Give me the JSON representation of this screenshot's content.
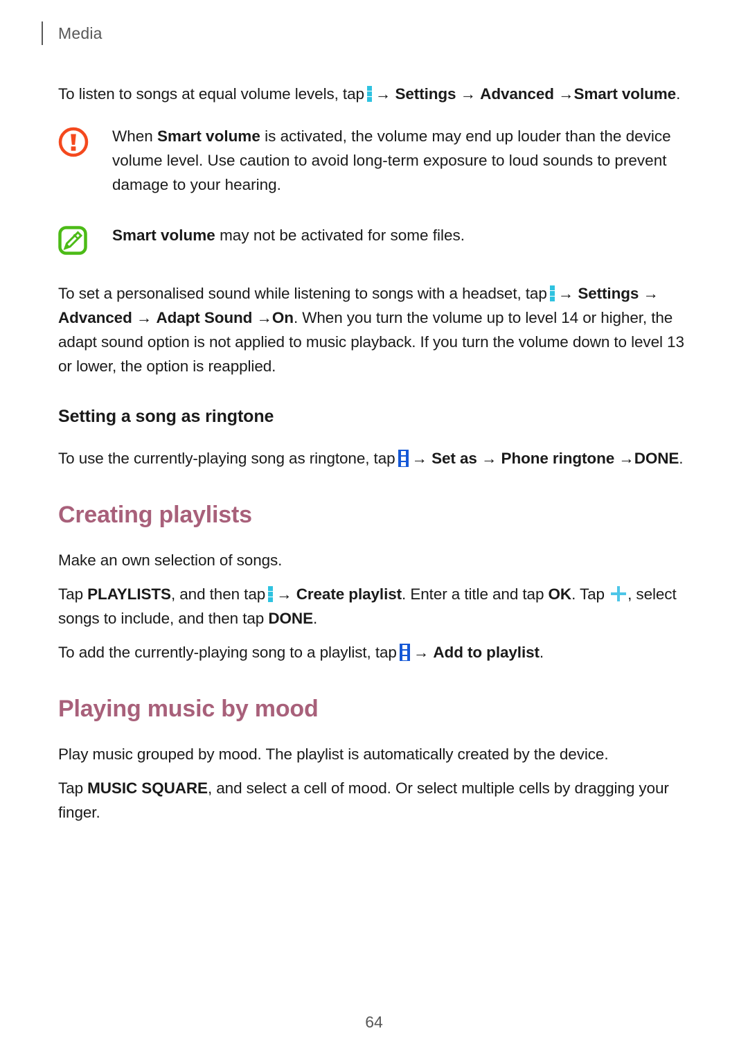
{
  "header": {
    "chapter_label": "Media"
  },
  "icons": {
    "more_menu": "more-vertical-icon",
    "more_menu_highlighted": "more-vertical-highlighted-icon",
    "plus": "plus-icon",
    "warning": "warning-icon",
    "note": "note-pencil-icon"
  },
  "colors": {
    "section_heading": "#a8607a",
    "inline_icon_cyan": "#2fc2e0",
    "inline_icon_highlight_bg": "#1558d6",
    "warning_icon": "#f4491e",
    "note_icon": "#4cbb17",
    "body_text": "#1a1a1a",
    "header_text": "#585858"
  },
  "content": {
    "smart_volume_intro": {
      "lead": "To listen to songs at equal volume levels, tap",
      "step_1": "Settings",
      "step_2": "Advanced",
      "step_3": "Smart volume",
      "trailing": "."
    },
    "warning_callout": {
      "part_1": "When ",
      "bold_1": "Smart volume",
      "part_2": " is activated, the volume may end up louder than the device volume level. Use caution to avoid long-term exposure to loud sounds to prevent damage to your hearing."
    },
    "note_callout": {
      "bold_1": "Smart volume",
      "part_1": " may not be activated for some files."
    },
    "adapt_sound": {
      "lead": "To set a personalised sound while listening to songs with a headset, tap",
      "step_1": "Settings",
      "step_2": "Advanced",
      "step_3": "Adapt Sound",
      "step_4": "On",
      "trailing": ". When you turn the volume up to level 14 or higher, the adapt sound option is not applied to music playback. If you turn the volume down to level 13 or lower, the option is reapplied."
    },
    "ringtone_heading": "Setting a song as ringtone",
    "ringtone_text": {
      "lead": "To use the currently-playing song as ringtone, tap",
      "step_1": "Set as",
      "step_2": "Phone ringtone",
      "step_3": "DONE",
      "trailing": "."
    },
    "playlists_heading": "Creating playlists",
    "playlists_intro": "Make an own selection of songs.",
    "playlists_steps": {
      "lead": "Tap ",
      "bold_1": "PLAYLISTS",
      "mid_1": ", and then tap",
      "bold_2": "Create playlist",
      "mid_2": ". Enter a title and tap ",
      "bold_3": "OK",
      "mid_3": ". Tap ",
      "mid_4": ", select songs to include, and then tap ",
      "bold_4": "DONE",
      "trailing": "."
    },
    "add_to_playlist": {
      "lead": "To add the currently-playing song to a playlist, tap",
      "step_1": "Add to playlist",
      "trailing": "."
    },
    "mood_heading": "Playing music by mood",
    "mood_intro": "Play music grouped by mood. The playlist is automatically created by the device.",
    "mood_steps": {
      "lead": "Tap ",
      "bold_1": "MUSIC SQUARE",
      "trailing": ", and select a cell of mood. Or select multiple cells by dragging your finger."
    }
  },
  "footer": {
    "page_number": "64"
  },
  "symbols": {
    "arrow": "→"
  }
}
